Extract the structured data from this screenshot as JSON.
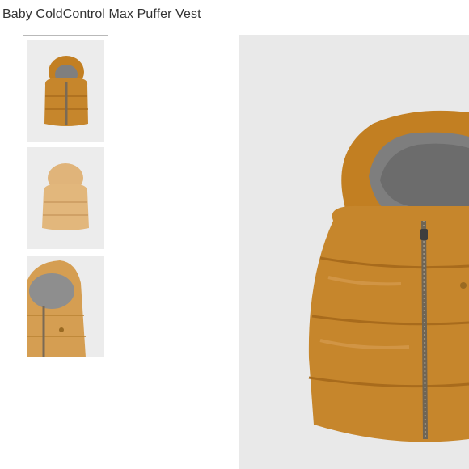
{
  "product": {
    "title": "Baby ColdControl Max Puffer Vest"
  },
  "gallery": {
    "selected_index": 0,
    "thumbnails": [
      {
        "view": "front",
        "selected": true
      },
      {
        "view": "back",
        "selected": false
      },
      {
        "view": "detail-close-up",
        "selected": false
      }
    ]
  },
  "colors": {
    "vest": "#c6862c",
    "vest_light": "#e2b77c",
    "lining": "#8a8a8a",
    "background": "#e9e9e9"
  }
}
